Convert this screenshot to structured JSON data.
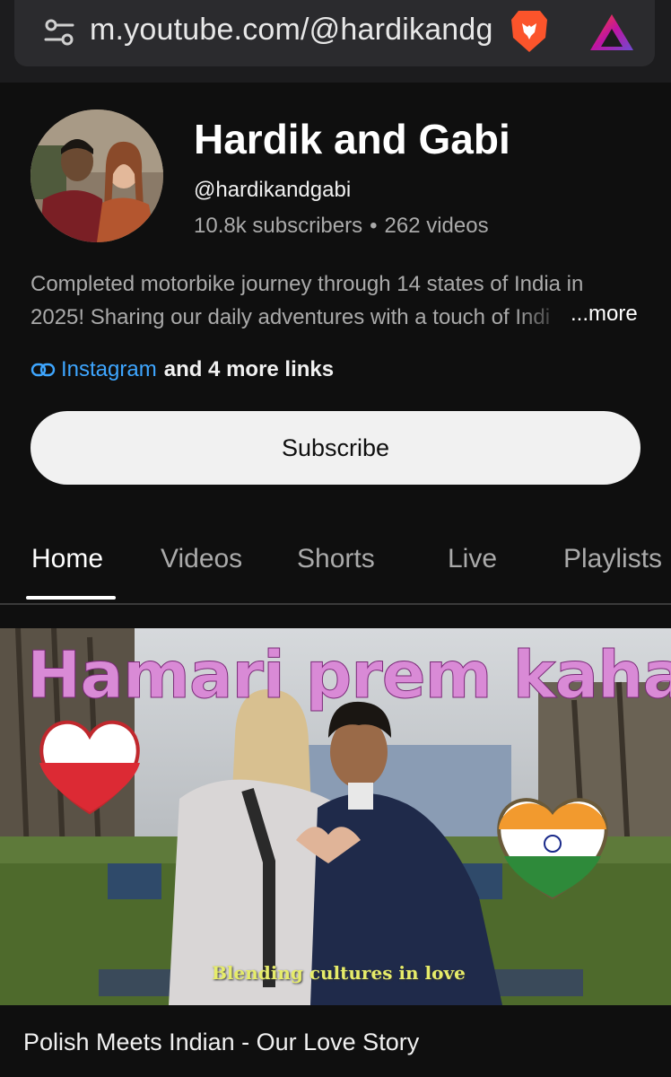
{
  "browser": {
    "url": "m.youtube.com/@hardikandg"
  },
  "channel": {
    "name": "Hardik and Gabi",
    "handle": "@hardikandgabi",
    "subscribers": "10.8k subscribers",
    "separator": "•",
    "videos": "262 videos",
    "description_line1": "Completed motorbike journey through 14 states of India in",
    "description_line2": "2025! Sharing our daily adventures with a touch of Indi",
    "more_label": "...more",
    "link_primary": "Instagram",
    "link_more": "and 4 more links",
    "subscribe_label": "Subscribe"
  },
  "tabs": [
    {
      "label": "Home",
      "active": true
    },
    {
      "label": "Videos",
      "active": false
    },
    {
      "label": "Shorts",
      "active": false
    },
    {
      "label": "Live",
      "active": false
    },
    {
      "label": "Playlists",
      "active": false
    }
  ],
  "featured_video": {
    "thumbnail_title": "Hamari prem kahani",
    "thumbnail_tagline": "Blending cultures in love",
    "title": "Polish Meets Indian - Our Love Story"
  },
  "icons": {
    "address_bar_left": "tune-icon",
    "browser_shield": "brave-lion-icon",
    "browser_rewards": "brave-rewards-icon",
    "link": "link-icon"
  },
  "colors": {
    "background": "#0f0f0f",
    "link_blue": "#3ea6ff",
    "secondary_text": "#aaaaaa",
    "subscribe_bg": "#f1f1f1",
    "brave_orange": "#fb542b",
    "thumbnail_title": "#d98ad6"
  }
}
